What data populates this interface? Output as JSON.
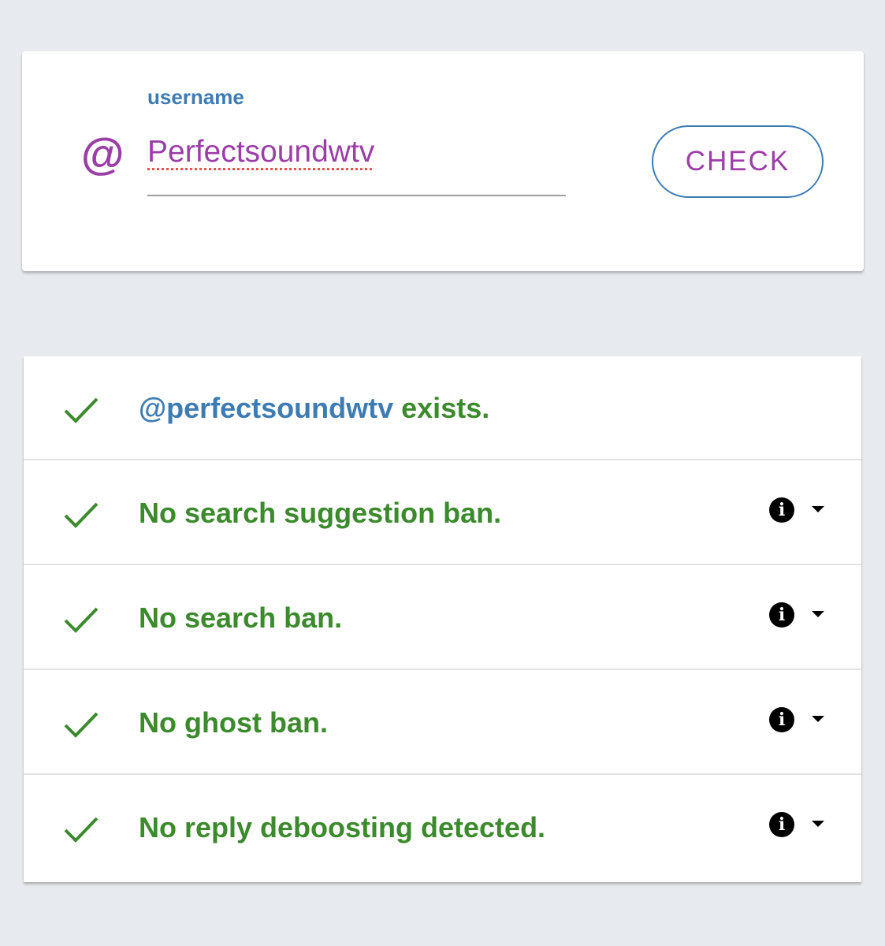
{
  "colors": {
    "accent": "#9b3ea7",
    "link": "#3d7bb3",
    "success": "#3b8a2c",
    "background": "#e7eaee"
  },
  "input": {
    "at_symbol": "@",
    "label": "username",
    "value": "Perfectsoundwtv",
    "button_label": "CHECK"
  },
  "results": {
    "exists": {
      "handle": "@perfectsoundwtv",
      "suffix": " exists."
    },
    "items": [
      {
        "label": "No search suggestion ban.",
        "info_icon": "i"
      },
      {
        "label": "No search ban.",
        "info_icon": "i"
      },
      {
        "label": "No ghost ban.",
        "info_icon": "i"
      },
      {
        "label": "No reply deboosting detected.",
        "info_icon": "i"
      }
    ]
  }
}
